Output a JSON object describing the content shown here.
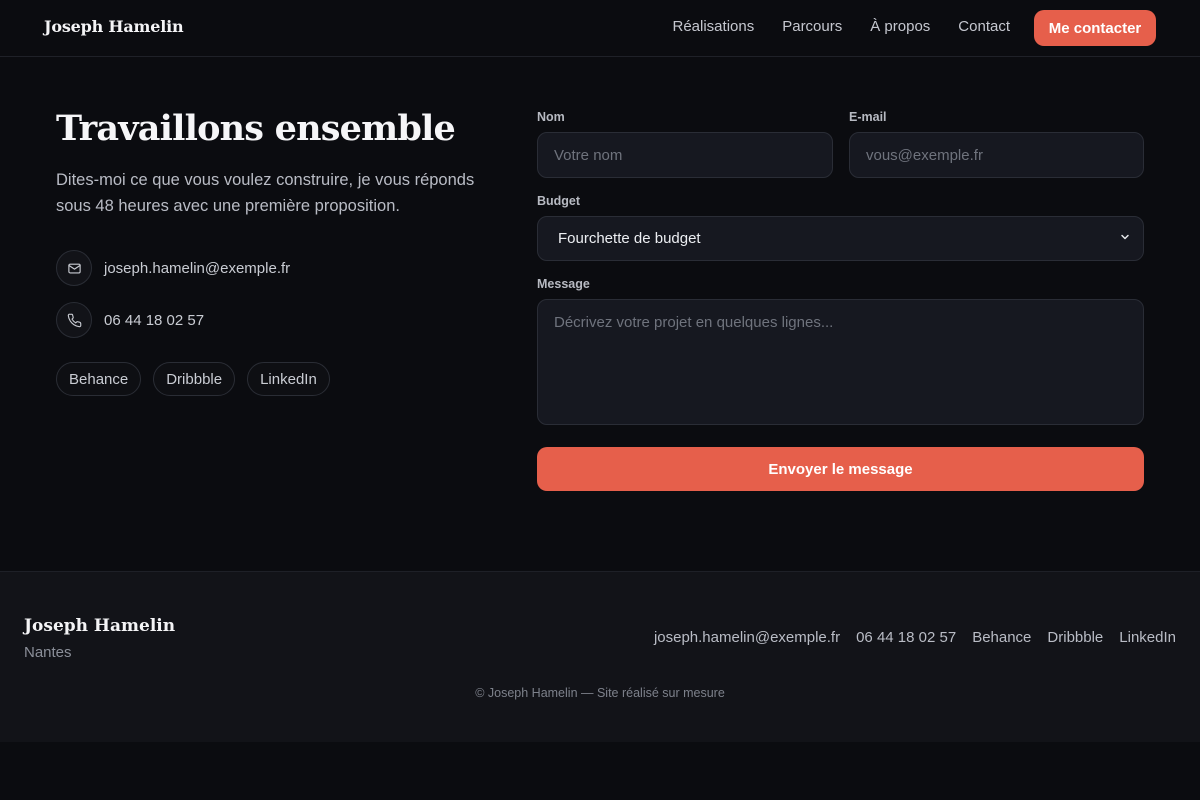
{
  "header": {
    "brand": "Joseph Hamelin",
    "nav": [
      "Réalisations",
      "Parcours",
      "À propos",
      "Contact"
    ],
    "cta_label": "Me contacter"
  },
  "hero": {
    "title": "Travaillons ensemble",
    "subtitle": "Dites-moi ce que vous voulez construire, je vous réponds sous 48 heures avec une première proposition."
  },
  "contact": {
    "email": "joseph.hamelin@exemple.fr",
    "phone": "06 44 18 02 57",
    "socials": [
      "Behance",
      "Dribbble",
      "LinkedIn"
    ]
  },
  "form": {
    "name_label": "Nom",
    "name_placeholder": "Votre nom",
    "email_label": "E-mail",
    "email_placeholder": "vous@exemple.fr",
    "budget_label": "Budget",
    "budget_selected": "Fourchette de budget",
    "message_label": "Message",
    "message_placeholder": "Décrivez votre projet en quelques lignes...",
    "submit_label": "Envoyer le message"
  },
  "footer": {
    "name": "Joseph Hamelin",
    "city": "Nantes",
    "links": [
      "joseph.hamelin@exemple.fr",
      "06 44 18 02 57",
      "Behance",
      "Dribbble",
      "LinkedIn"
    ],
    "copyright": "© Joseph Hamelin — Site réalisé sur mesure"
  },
  "colors": {
    "accent": "#e65f4b",
    "background": "#0b0c10",
    "surface": "#161820"
  }
}
